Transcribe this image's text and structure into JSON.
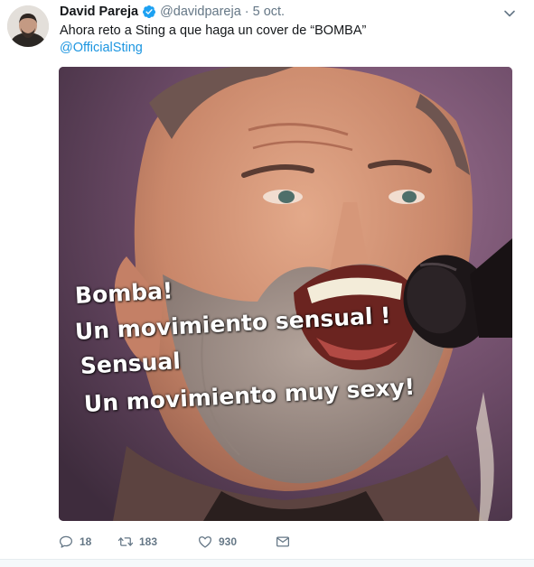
{
  "tweet": {
    "author_name": "David Pareja",
    "handle": "@davidpareja",
    "separator": "·",
    "time": "5 oct.",
    "text": "Ahora reto a Sting a que haga un cover de “BOMBA”",
    "mention": "@OfficialSting"
  },
  "media": {
    "overlay_lines": [
      "Bomba!",
      "Un movimiento sensual !",
      "Sensual",
      "Un movimiento muy sexy!"
    ]
  },
  "actions": {
    "reply_count": "18",
    "retweet_count": "183",
    "like_count": "930"
  },
  "colors": {
    "link": "#1b95e0",
    "secondary": "#657786",
    "verified": "#1da1f2"
  },
  "icons": [
    "caret-down-icon",
    "verified-badge-icon",
    "reply-icon",
    "retweet-icon",
    "like-icon",
    "message-icon"
  ]
}
